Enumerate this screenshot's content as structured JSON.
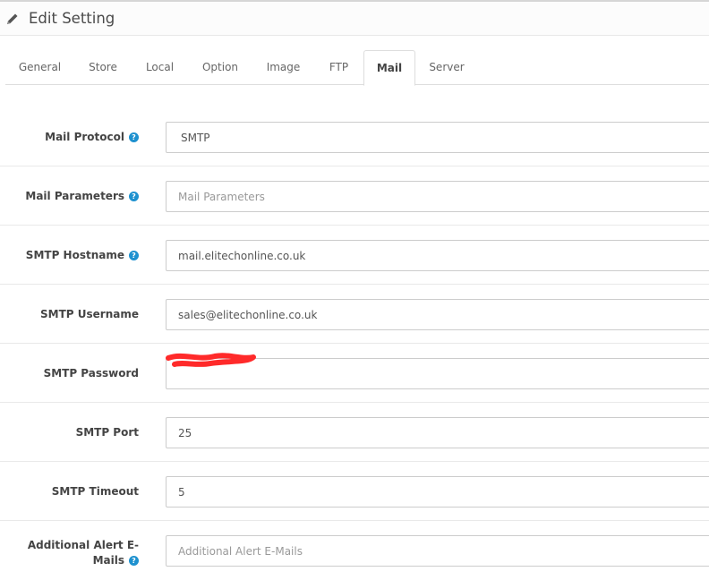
{
  "header": {
    "title": "Edit Setting",
    "icon": "pencil-icon"
  },
  "tabs": [
    {
      "label": "General"
    },
    {
      "label": "Store"
    },
    {
      "label": "Local"
    },
    {
      "label": "Option"
    },
    {
      "label": "Image"
    },
    {
      "label": "FTP"
    },
    {
      "label": "Mail",
      "active": true
    },
    {
      "label": "Server"
    }
  ],
  "form": {
    "mail_protocol": {
      "label": "Mail Protocol",
      "value": "SMTP",
      "help_icon": "question-icon"
    },
    "mail_parameters": {
      "label": "Mail Parameters",
      "value": "",
      "placeholder": "Mail Parameters",
      "help_icon": "question-icon"
    },
    "smtp_hostname": {
      "label": "SMTP Hostname",
      "value": "mail.elitechonline.co.uk",
      "help_icon": "question-icon"
    },
    "smtp_username": {
      "label": "SMTP Username",
      "value": "sales@elitechonline.co.uk"
    },
    "smtp_password": {
      "label": "SMTP Password",
      "value": "",
      "redaction_color": "#ff2a2a"
    },
    "smtp_port": {
      "label": "SMTP Port",
      "value": "25"
    },
    "smtp_timeout": {
      "label": "SMTP Timeout",
      "value": "5"
    },
    "additional_alert_emails": {
      "label": "Additional Alert E-Mails",
      "value": "",
      "placeholder": "Additional Alert E-Mails",
      "help_icon": "question-icon"
    }
  },
  "colors": {
    "help_icon": "#1e91cf",
    "active_tab_border": "#dddddd"
  }
}
